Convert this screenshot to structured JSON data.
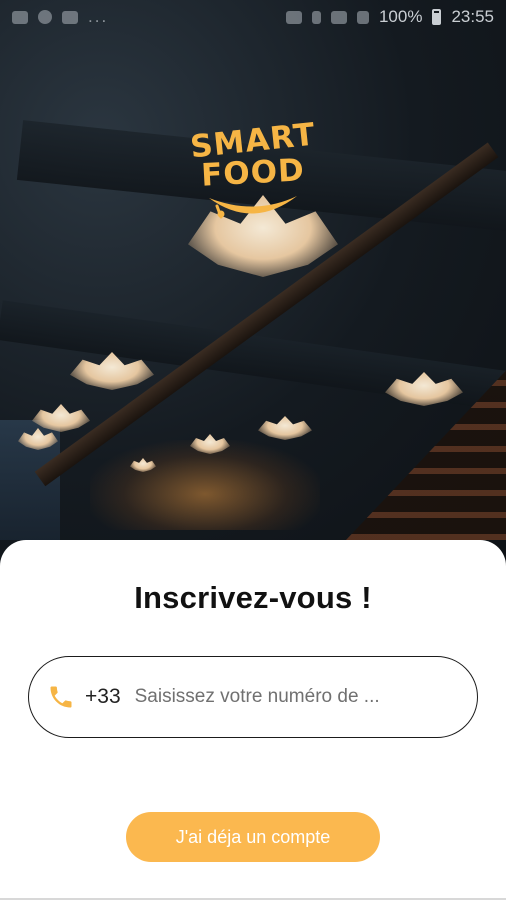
{
  "status_bar": {
    "battery": "100%",
    "time": "23:55",
    "more_indicator": "..."
  },
  "logo": {
    "line1": "SMART",
    "line2": "FOOD",
    "color": "#F6B545"
  },
  "signup": {
    "title": "Inscrivez-vous !",
    "phone_icon": "phone-icon",
    "country_code": "+33",
    "phone_placeholder": "Saisissez votre numéro de ...",
    "phone_value": ""
  },
  "actions": {
    "existing_account_label": "J'ai déja un compte"
  },
  "colors": {
    "accent": "#FBB84F",
    "sheet_background": "#FFFFFF",
    "title_text": "#111111"
  }
}
